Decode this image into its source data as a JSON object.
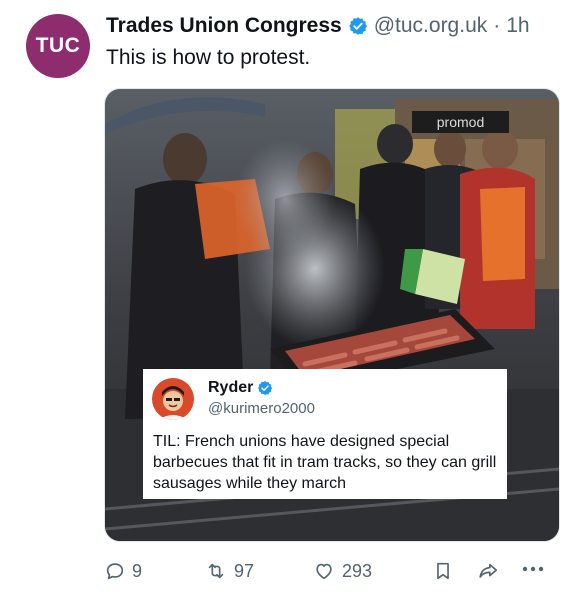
{
  "account": {
    "display_name": "Trades Union Congress",
    "handle": "@tuc.org.uk",
    "time": "1h",
    "avatar_text": "TUC",
    "avatar_color": "#8e2d6e"
  },
  "tweet": {
    "text": "This is how to protest."
  },
  "media": {
    "storefront_sign": "promod"
  },
  "quoted": {
    "name": "Ryder",
    "handle": "@kurimero2000",
    "text": "TIL:  French unions have designed special barbecues that fit in tram tracks, so they can grill sausages while they march"
  },
  "actions": {
    "replies": "9",
    "reposts": "97",
    "likes": "293"
  },
  "colors": {
    "verified": "#1d9bf0",
    "muted": "#536471"
  }
}
